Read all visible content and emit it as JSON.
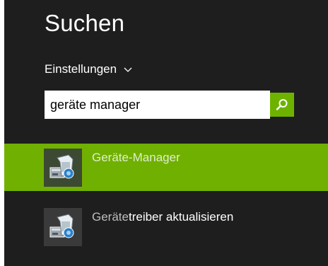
{
  "header": {
    "title": "Suchen"
  },
  "scope": {
    "label": "Einstellungen",
    "icon": "chevron-down-icon"
  },
  "search": {
    "value": "geräte manager",
    "button_icon": "search-icon"
  },
  "results": [
    {
      "label": "Geräte-Manager",
      "icon": "device-manager-icon",
      "selected": true
    },
    {
      "label_prefix": "Geräte",
      "label_rest": "treiber aktualisieren",
      "icon": "device-manager-icon",
      "selected": false
    }
  ],
  "colors": {
    "accent": "#70b000",
    "background": "#1e1e1e"
  }
}
